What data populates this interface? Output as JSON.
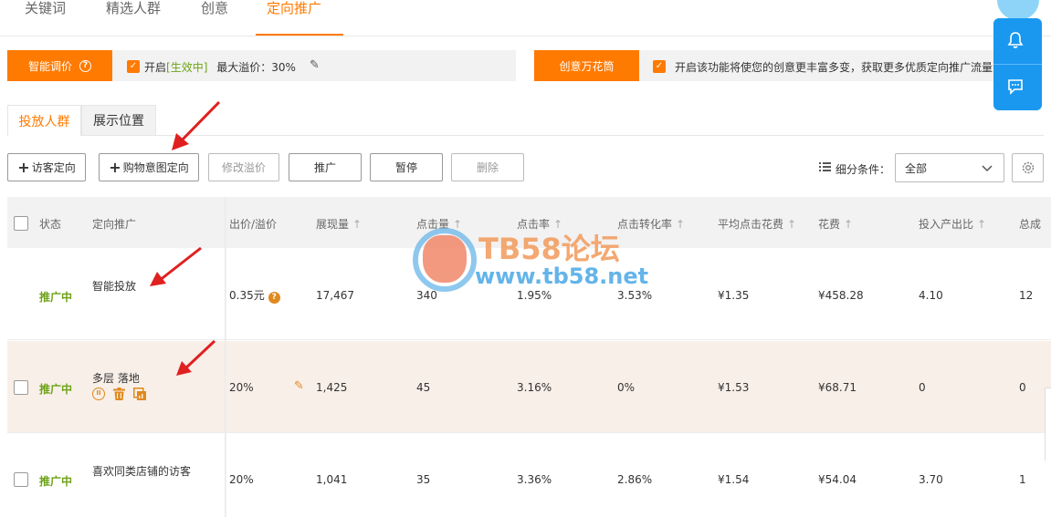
{
  "top_tabs": [
    "关键词",
    "精选人群",
    "创意",
    "定向推广"
  ],
  "smart_bid": {
    "button_label": "智能调价",
    "toggle_label": "开启",
    "status": "[生效中]",
    "max_premium": "最大溢价：30%"
  },
  "creative": {
    "button_label": "创意万花筒",
    "description": "开启该功能将使您的创意更丰富多变，获取更多优质定向推广流量"
  },
  "sub_tabs": [
    "投放人群",
    "展示位置"
  ],
  "toolbar": {
    "add_visitor": "访客定向",
    "add_shopping": "购物意图定向",
    "edit_premium": "修改溢价",
    "promote": "推广",
    "pause": "暂停",
    "delete": "删除",
    "filter_label": "细分条件：",
    "filter_value": "全部"
  },
  "table": {
    "headers": {
      "status": "状态",
      "target": "定向推广",
      "bid": "出价/溢价",
      "impressions": "展现量",
      "clicks": "点击量",
      "ctr": "点击率",
      "cvr": "点击转化率",
      "cpc": "平均点击花费",
      "cost": "花费",
      "roi": "投入产出比",
      "total": "总成"
    },
    "rows": [
      {
        "status": "推广中",
        "name": "智能投放",
        "bid": "0.35元",
        "impressions": "17,467",
        "clicks": "340",
        "ctr": "1.95%",
        "cvr": "3.53%",
        "cpc": "¥1.35",
        "cost": "¥458.28",
        "roi": "4.10",
        "total": "12"
      },
      {
        "status": "推广中",
        "name": "多层 落地",
        "bid": "20%",
        "impressions": "1,425",
        "clicks": "45",
        "ctr": "3.16%",
        "cvr": "0%",
        "cpc": "¥1.53",
        "cost": "¥68.71",
        "roi": "0",
        "total": "0"
      },
      {
        "status": "推广中",
        "name": "喜欢同类店铺的访客",
        "bid": "20%",
        "impressions": "1,041",
        "clicks": "35",
        "ctr": "3.36%",
        "cvr": "2.86%",
        "cpc": "¥1.54",
        "cost": "¥54.04",
        "roi": "3.70",
        "total": "1"
      }
    ]
  },
  "watermark": {
    "title": "TB58论坛",
    "url": "www.tb58.net"
  },
  "colors": {
    "accent": "#ff7a00",
    "status_green": "#6da317",
    "float_blue": "#1a98f0",
    "row_highlight": "#f8efe8",
    "arrow_red": "#e02020"
  }
}
